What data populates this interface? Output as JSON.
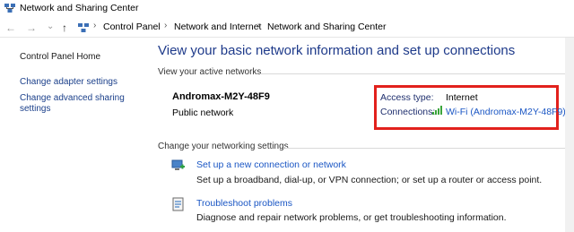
{
  "window": {
    "title": "Network and Sharing Center"
  },
  "address_bar": {
    "back_glyph": "←",
    "forward_glyph": "→",
    "dropdown_glyph": "⌄",
    "up_glyph": "↑",
    "separator": "›",
    "breadcrumbs": [
      "Control Panel",
      "Network and Internet",
      "Network and Sharing Center"
    ]
  },
  "sidebar": {
    "home": "Control Panel Home",
    "links": [
      "Change adapter settings",
      "Change advanced sharing",
      "settings"
    ]
  },
  "main": {
    "heading": "View your basic network information and set up connections",
    "active_section": "View your active networks",
    "network": {
      "name": "Andromax-M2Y-48F9",
      "type": "Public network",
      "access_type_label": "Access type:",
      "access_type_value": "Internet",
      "connections_label": "Connections:",
      "connections_value": "Wi-Fi (Andromax-M2Y-48F9)"
    },
    "change_section": "Change your networking settings",
    "items": [
      {
        "title": "Set up a new connection or network",
        "desc": "Set up a broadband, dial-up, or VPN connection; or set up a router or access point."
      },
      {
        "title": "Troubleshoot problems",
        "desc": "Diagnose and repair network problems, or get troubleshooting information."
      }
    ]
  },
  "colors": {
    "highlight_box": "#e2211c",
    "link": "#1a56c4",
    "heading": "#1e3a8a"
  }
}
